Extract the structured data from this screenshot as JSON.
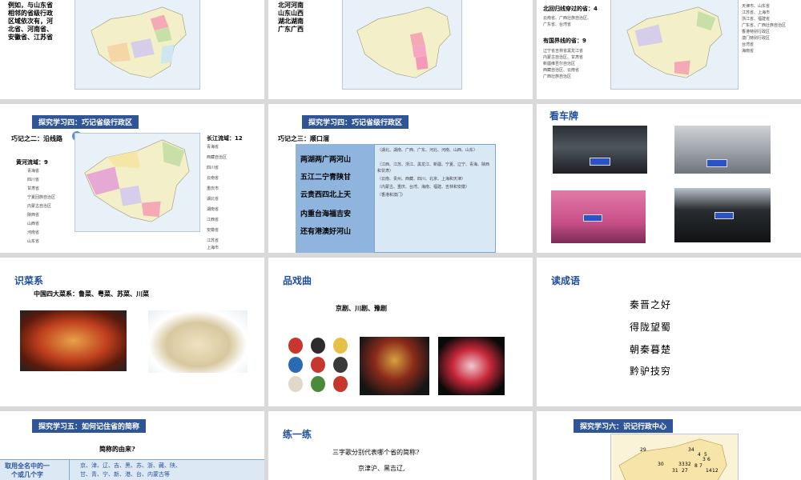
{
  "slide1": {
    "text_lines": [
      "例如，与山东省",
      "相邻的省级行政",
      "区域依次有，河",
      "北省、河南省、",
      "安徽省、江苏省"
    ]
  },
  "slide2": {
    "text_lines": [
      "北河河南",
      "山东山西",
      "湖北湖南",
      "广东广西"
    ]
  },
  "slide3": {
    "tropic_label": "北回归线穿过的省：",
    "tropic_count": "4",
    "tropic_provinces": [
      "云南省、广西壮族自治区、",
      "广东省、台湾省"
    ],
    "border_label": "有国界线的省：",
    "border_count": "9",
    "border_provinces": [
      "辽宁省吉林省黑龙江省",
      "内蒙古自治区、甘肃省",
      "新疆维吾尔自治区",
      "西藏自治区、云南省",
      "广西壮族自治区"
    ],
    "coast_provinces": [
      "天津市、山东省",
      "江苏省、上海市",
      "浙江省、福建省",
      "广东省、广西壮族自治区",
      "香港特别行政区",
      "澳门特别行政区",
      "台湾省",
      "海南省"
    ]
  },
  "slide4": {
    "band": "探究学习四：巧记省级行政区",
    "subtitle": "巧记之二：沿线路",
    "yellow_label": "黄河流域：",
    "yellow_count": "9",
    "yellow_list": [
      "青海省",
      "四川省",
      "甘肃省",
      "宁夏回族自治区",
      "内蒙古自治区",
      "陕西省",
      "山西省",
      "河南省",
      "山东省"
    ],
    "yangtze_label": "长江流域：",
    "yangtze_count": "12",
    "yangtze_list": [
      "青海省",
      "西藏自治区",
      "四川省",
      "云南省",
      "重庆市",
      "湖北省",
      "湖南省",
      "江西省",
      "安徽省",
      "江苏省",
      "上海市"
    ]
  },
  "slide5": {
    "band": "探究学习四：巧记省级行政区",
    "subtitle": "巧记之三：顺口溜",
    "rows": [
      {
        "label": "两湖两广两河山",
        "note": "（湖北、湖南、广西、广东、河北、河南、山西、山东）"
      },
      {
        "label": "五江二宁青陕甘",
        "note": "（江西、江苏、浙江、黑龙江、新疆、宁夏、辽宁、青海、陕西和甘肃）"
      },
      {
        "label": "云贵西四北上天",
        "note": "（云南、贵州、西藏、四川、北京、上海和天津）"
      },
      {
        "label": "内重台海福吉安",
        "note": "（内蒙古、重庆、台湾、海南、福建、吉林和安徽）"
      },
      {
        "label": "还有港澳好河山",
        "note": "（香港和澳门）"
      }
    ]
  },
  "slide6": {
    "title": "看车牌"
  },
  "slide7": {
    "title": "识菜系",
    "text": "中国四大菜系：鲁菜、粤菜、苏菜、川菜"
  },
  "slide8": {
    "title": "品戏曲",
    "text": "京剧、川剧、豫剧"
  },
  "slide9": {
    "title": "读成语",
    "idioms": [
      "秦晋之好",
      "得陇望蜀",
      "朝秦暮楚",
      "黔驴技穷"
    ]
  },
  "slide10": {
    "band": "探究学习五：如何记住省的简称",
    "question": "简称的由来?",
    "left_cell": [
      "取用全名中的一",
      "个或几个字"
    ],
    "right_cell": [
      "京、津、辽、吉、黑、苏、浙、藏、陕、",
      "甘、青、宁、新、港、台、内蒙古等"
    ]
  },
  "slide11": {
    "title": "练一练",
    "question": "三字歌分别代表哪个省的简称?",
    "line1": "京津沪、黑吉辽,",
    "line2": "……"
  },
  "slide12": {
    "band": "探究学习六：识记行政中心",
    "numbers": [
      "29",
      "34",
      "4",
      "5",
      "3",
      "6",
      "30",
      "33",
      "32",
      "8",
      "7",
      "31",
      "27",
      "14",
      "12"
    ]
  },
  "colors": {
    "band": "#2f5597",
    "title_blue": "#1f4e9c",
    "background": "#d9d9d9",
    "table_left": "#8fb4dd",
    "table_right": "#d9e8f5"
  }
}
